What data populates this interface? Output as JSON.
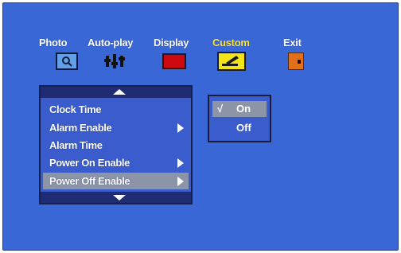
{
  "nav": {
    "items": [
      {
        "label": "Photo",
        "icon": "magnifier-icon"
      },
      {
        "label": "Auto-play",
        "icon": "sliders-icon"
      },
      {
        "label": "Display",
        "icon": "screen-icon"
      },
      {
        "label": "Custom",
        "icon": "pencil-icon",
        "selected": true
      },
      {
        "label": "Exit",
        "icon": "door-icon"
      }
    ]
  },
  "menu": {
    "items": [
      {
        "label": "Clock Time"
      },
      {
        "label": "Alarm Enable",
        "has_submenu": true
      },
      {
        "label": "Alarm Time"
      },
      {
        "label": "Power On Enable",
        "has_submenu": true
      },
      {
        "label": "Power Off Enable",
        "has_submenu": true,
        "selected": true
      }
    ]
  },
  "submenu": {
    "items": [
      {
        "check": "√",
        "label": "On",
        "selected": true
      },
      {
        "check": "",
        "label": "Off"
      }
    ]
  },
  "colors": {
    "background": "#3a67d6",
    "highlight": "#8c95a8",
    "selected_label": "#ffe63a"
  }
}
